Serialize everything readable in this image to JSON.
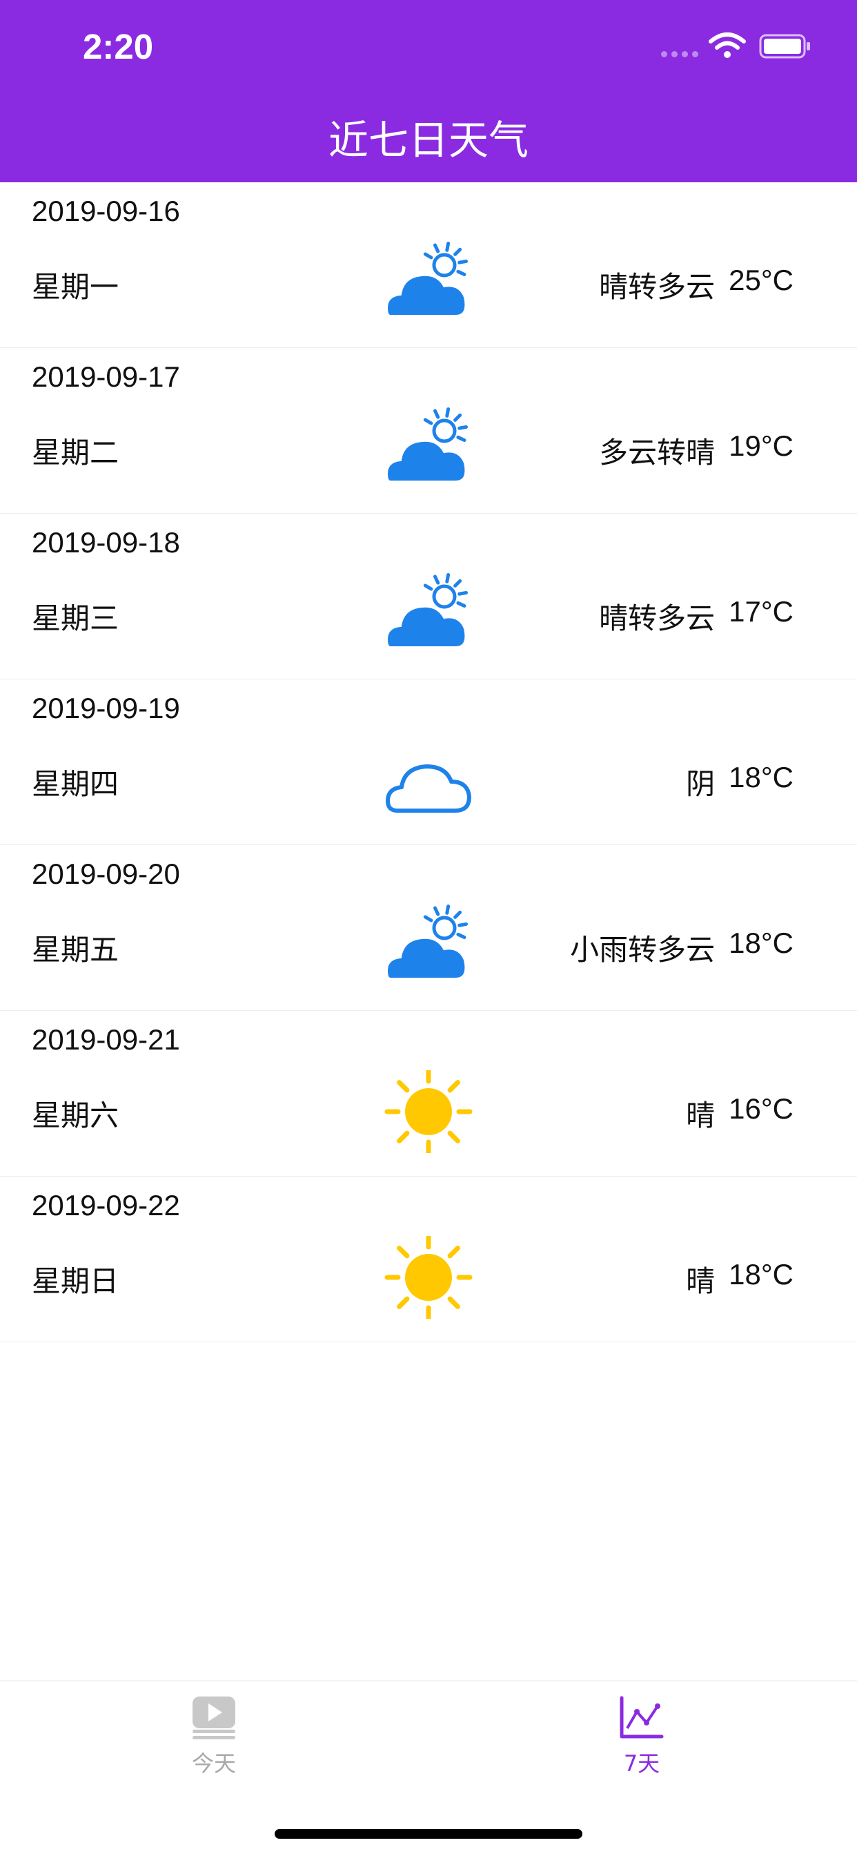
{
  "status_bar": {
    "time": "2:20"
  },
  "nav": {
    "title": "近七日天气"
  },
  "colors": {
    "accent": "#8A2BE2",
    "weather_blue": "#1E82EB",
    "sun_yellow": "#FFC800"
  },
  "forecast": [
    {
      "date": "2019-09-16",
      "weekday": "星期一",
      "icon": "partly-cloudy-icon",
      "condition": "晴转多云",
      "temp": "25°C"
    },
    {
      "date": "2019-09-17",
      "weekday": "星期二",
      "icon": "partly-cloudy-icon",
      "condition": "多云转晴",
      "temp": "19°C"
    },
    {
      "date": "2019-09-18",
      "weekday": "星期三",
      "icon": "partly-cloudy-icon",
      "condition": "晴转多云",
      "temp": "17°C"
    },
    {
      "date": "2019-09-19",
      "weekday": "星期四",
      "icon": "cloud-outline-icon",
      "condition": "阴",
      "temp": "18°C"
    },
    {
      "date": "2019-09-20",
      "weekday": "星期五",
      "icon": "partly-cloudy-icon",
      "condition": "小雨转多云",
      "temp": "18°C"
    },
    {
      "date": "2019-09-21",
      "weekday": "星期六",
      "icon": "sun-icon",
      "condition": "晴",
      "temp": "16°C"
    },
    {
      "date": "2019-09-22",
      "weekday": "星期日",
      "icon": "sun-icon",
      "condition": "晴",
      "temp": "18°C"
    }
  ],
  "tabbar": {
    "tabs": [
      {
        "label": "今天",
        "icon": "today-icon",
        "selected": false
      },
      {
        "label": "7天",
        "icon": "line-chart-icon",
        "selected": true
      }
    ]
  }
}
